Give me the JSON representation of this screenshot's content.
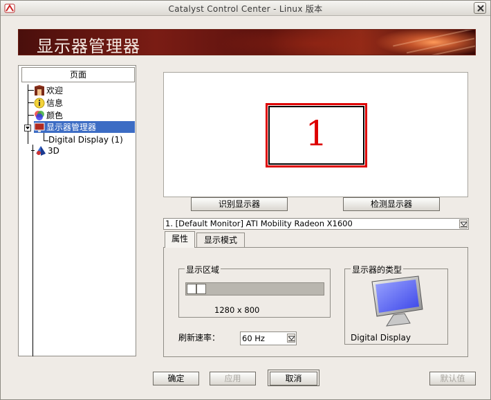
{
  "window": {
    "title": "Catalyst Control Center - Linux 版本",
    "banner_title": "显示器管理器"
  },
  "sidebar": {
    "header": "页面",
    "items": [
      {
        "label": "欢迎",
        "icon": "welcome-icon"
      },
      {
        "label": "信息",
        "icon": "info-icon"
      },
      {
        "label": "颜色",
        "icon": "color-icon"
      },
      {
        "label": "显示器管理器",
        "icon": "display-manager-icon",
        "selected": true
      },
      {
        "label": "Digital Display (1)"
      },
      {
        "label": "3D",
        "icon": "3d-icon"
      }
    ]
  },
  "preview": {
    "monitor_number": "1",
    "identify_button": "识别显示器",
    "detect_button": "检测显示器"
  },
  "monitor_select": {
    "value": "1. [Default Monitor] ATI Mobility Radeon X1600"
  },
  "tabs": [
    {
      "label": "属性",
      "active": true
    },
    {
      "label": "显示模式",
      "active": false
    }
  ],
  "properties": {
    "display_area_title": "显示区域",
    "resolution": "1280 x 800",
    "refresh_label": "刷新速率：",
    "refresh_value": "60 Hz",
    "display_type_title": "显示器的类型",
    "display_type_value": "Digital Display"
  },
  "buttons": {
    "ok": "确定",
    "apply": "应用",
    "cancel": "取消",
    "defaults": "默认值"
  },
  "colors": {
    "accent_red": "#dd0000",
    "selection_blue": "#3c6cc4"
  }
}
